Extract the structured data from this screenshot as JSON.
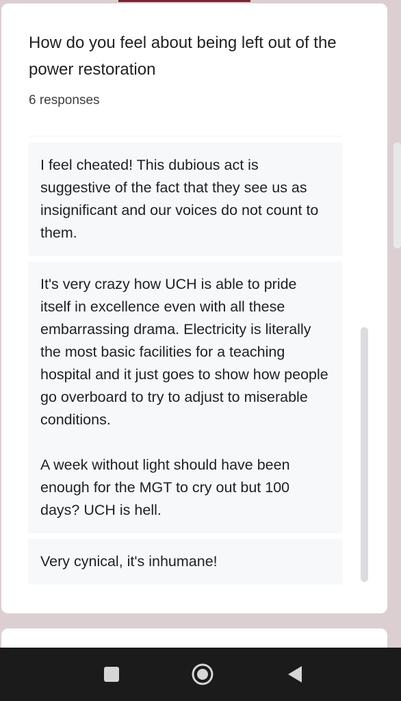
{
  "question": {
    "title": "How do you feel about being left out of the power restoration",
    "response_count": "6 responses"
  },
  "responses": [
    "",
    "I feel cheated! This dubious act is suggestive of the fact that they see us as insignificant and our voices do not count to them.",
    "It's very crazy how UCH is able to pride itself in excellence even with all these embarrassing drama. Electricity is literally the most basic facilities for a teaching hospital and it just goes to show how people go overboard to try to adjust to miserable conditions.\n\nA week without light should have been enough for the MGT to cry out but 100 days? UCH is hell.",
    "Very cynical, it's inhumane!"
  ],
  "nav": {
    "recents_icon": "square-recents-icon",
    "home_icon": "circle-home-icon",
    "back_icon": "triangle-back-icon"
  },
  "colors": {
    "page_background": "#dccfd1",
    "accent": "#7a2233",
    "response_background": "#f7f8fa",
    "nav_background": "#1b1b1b"
  }
}
